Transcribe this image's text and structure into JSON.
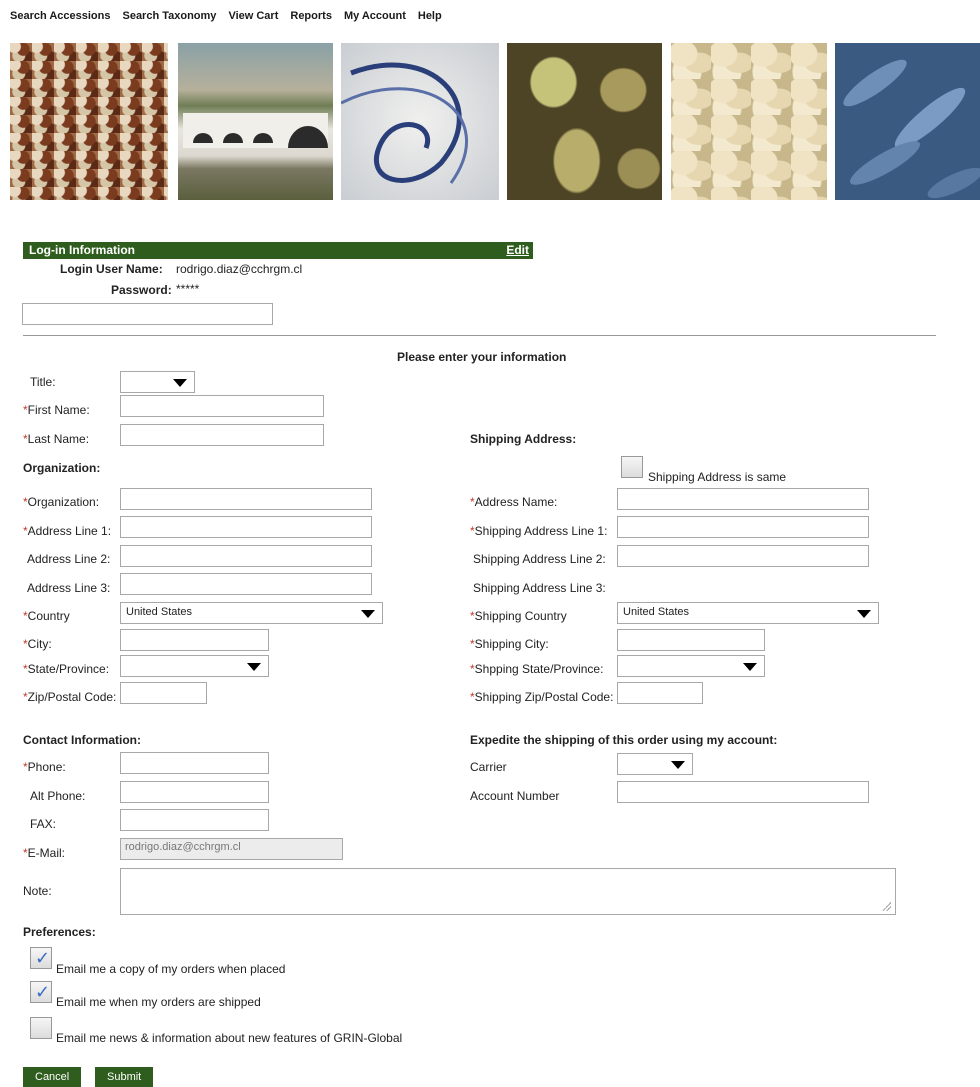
{
  "nav": [
    "Search Accessions",
    "Search Taxonomy",
    "View Cart",
    "Reports",
    "My Account",
    "Help"
  ],
  "login": {
    "header": "Log-in Information",
    "edit": "Edit",
    "username_label": "Login User Name:",
    "username_value": "rodrigo.diaz@cchrgm.cl",
    "password_label": "Password:",
    "password_value": "*****"
  },
  "form_title": "Please enter your information",
  "labels": {
    "title": "Title:",
    "first_name": "First Name:",
    "last_name": "Last Name:",
    "organization_section": "Organization:",
    "organization": "Organization:",
    "addr1": "Address Line 1:",
    "addr2": "Address Line 2:",
    "addr3": "Address Line 3:",
    "country": "Country",
    "city": "City:",
    "state": "State/Province:",
    "zip": "Zip/Postal Code:",
    "shipping_section": "Shipping Address:",
    "shipping_same": "Shipping Address is same",
    "ship_name": "Address Name:",
    "ship_addr1": "Shipping Address Line 1:",
    "ship_addr2": "Shipping Address Line 2:",
    "ship_addr3": "Shipping Address Line 3:",
    "ship_country": "Shipping Country",
    "ship_city": "Shipping City:",
    "ship_state": "Shpping State/Province:",
    "ship_zip": "Shipping Zip/Postal Code:",
    "contact_section": "Contact Information:",
    "phone": "Phone:",
    "alt_phone": "Alt Phone:",
    "fax": "FAX:",
    "email": "E-Mail:",
    "note": "Note:",
    "expedite_section": "Expedite the shipping of this order using my account:",
    "carrier": "Carrier",
    "account_number": "Account Number",
    "preferences": "Preferences:"
  },
  "values": {
    "country": "United States",
    "ship_country": "United States",
    "email": "rodrigo.diaz@cchrgm.cl"
  },
  "preferences": [
    {
      "label": "Email me a copy of my orders when placed",
      "checked": true
    },
    {
      "label": "Email me when my orders are shipped",
      "checked": true
    },
    {
      "label": "Email me news & information about new features of GRIN-Global",
      "checked": false
    }
  ],
  "buttons": {
    "cancel": "Cancel",
    "submit": "Submit"
  },
  "colors": {
    "header_green": "#2f5d1e",
    "required_red": "#c0392b",
    "check_blue": "#3b6cc4"
  },
  "icons": {
    "dropdown": "triangle-down",
    "checkmark": "check"
  }
}
